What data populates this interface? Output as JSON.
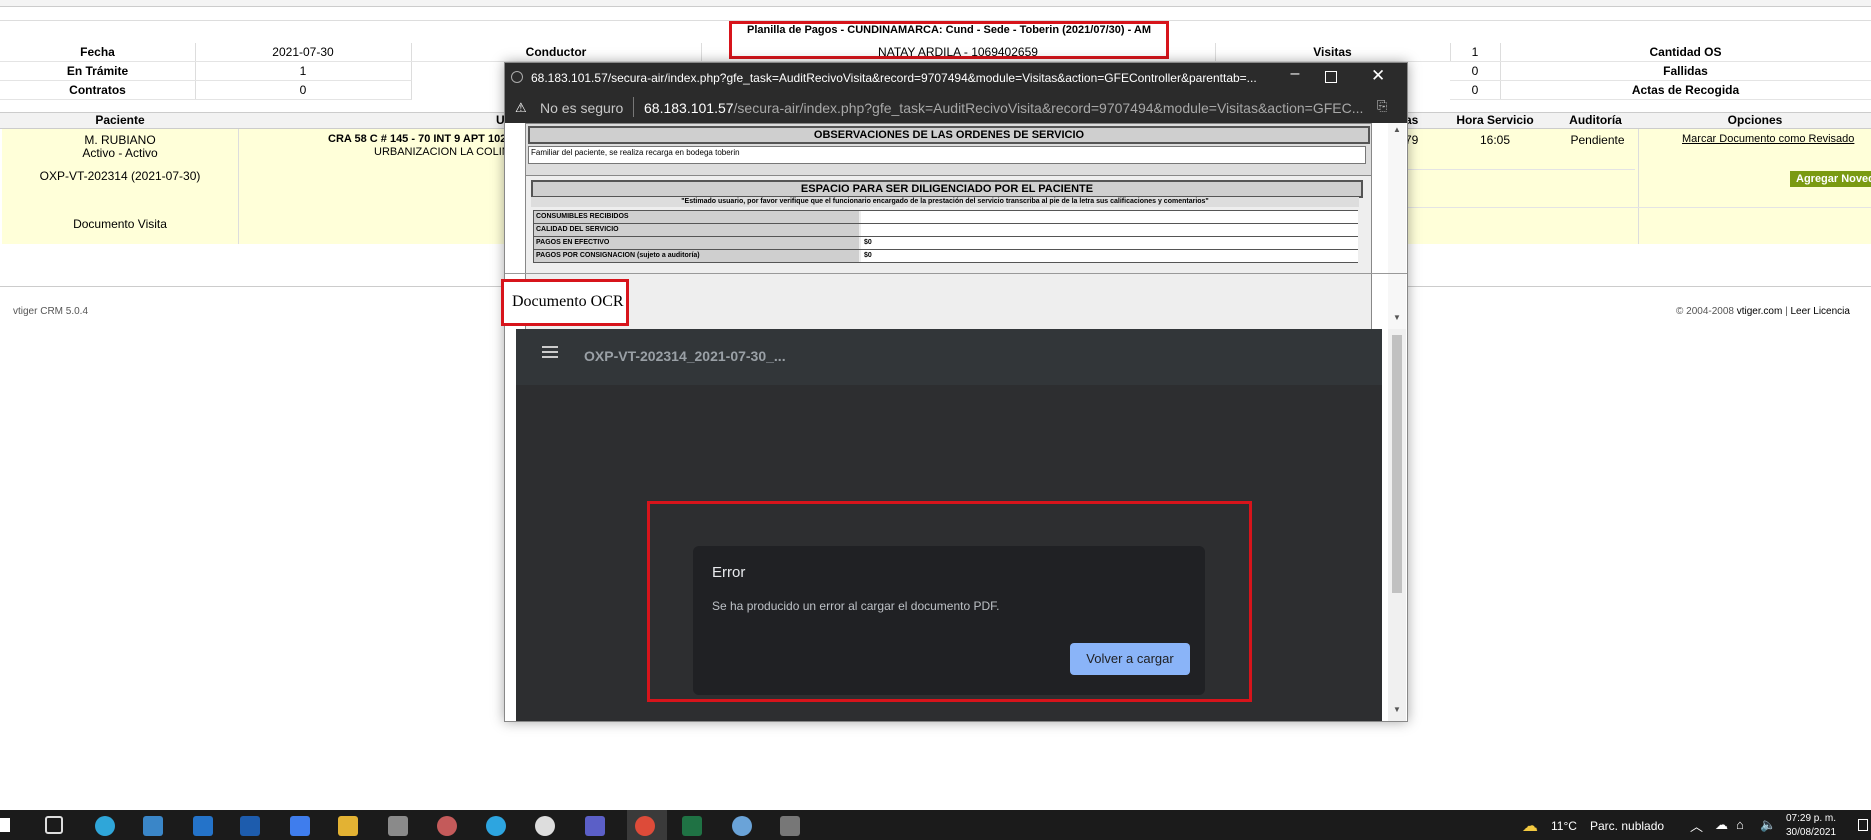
{
  "crm": {
    "title": "Planilla de Pagos - CUNDINAMARCA: Cund - Sede - Toberin (2021/07/30) - AM",
    "row1": {
      "fecha_label": "Fecha",
      "fecha_value": "2021-07-30",
      "conductor_label": "Conductor",
      "conductor_value": "NATAY ARDILA - 1069402659",
      "visitas_label": "Visitas",
      "visitas_value": "1",
      "cantidad_label": "Cantidad OS"
    },
    "row2": {
      "tramite_label": "En Trámite",
      "tramite_value": "1",
      "value2": "0",
      "fallidas_label": "Fallidas"
    },
    "row3": {
      "contratos_label": "Contratos",
      "contratos_value": "0",
      "value3": "0",
      "actas_label": "Actas de Recogida"
    },
    "headers": {
      "paciente": "Paciente",
      "u": "U",
      "as": "as",
      "hora": "Hora Servicio",
      "auditoria": "Auditoría",
      "opciones": "Opciones"
    },
    "row_data": {
      "name": "M. RUBIANO",
      "status": "Activo - Activo",
      "code": "OXP-VT-202314 (2021-07-30)",
      "doc": "Documento Visita",
      "address1": "CRA 58 C # 145 - 70 INT 9 APT 102",
      "address2": "URBANIZACION LA COLIN",
      "n79": "79",
      "hora": "16:05",
      "audit": "Pendiente",
      "mark": "Marcar Documento como Revisado",
      "add_btn": "Agregar Noved"
    },
    "footer_left": "vtiger CRM 5.0.4",
    "footer_right_prefix": "© 2004-2008 ",
    "footer_right_link1": "vtiger.com",
    "footer_right_sep": " | ",
    "footer_right_link2": "Leer Licencia"
  },
  "popup": {
    "title_url": "68.183.101.57/secura-air/index.php?gfe_task=AuditRecivoVisita&record=9707494&module=Visitas&action=GFEController&parenttab=...",
    "not_secure": "No es seguro",
    "address_host": "68.183.101.57",
    "address_path": "/secura-air/index.php?gfe_task=AuditRecivoVisita&record=9707494&module=Visitas&action=GFEC...",
    "obs_header": "OBSERVACIONES DE LAS ORDENES DE SERVICIO",
    "obs_text": "Familiar del paciente, se realiza recarga en bodega toberin",
    "space_header": "ESPACIO PARA SER DILIGENCIADO POR EL PACIENTE",
    "space_sub": "\"Estimado usuario, por favor verifique que el funcionario encargado de la prestación del servicio transcriba al pie de la letra sus calificaciones y comentarios\"",
    "rows": [
      {
        "label": "CONSUMIBLES RECIBIDOS",
        "value": ""
      },
      {
        "label": "CALIDAD DEL SERVICIO",
        "value": ""
      },
      {
        "label": "PAGOS EN EFECTIVO",
        "value": "$0"
      },
      {
        "label": "PAGOS POR CONSIGNACION (sujeto a auditoría)",
        "value": "$0"
      }
    ],
    "ocr_label": "Documento OCR",
    "pdf_filename": "OXP-VT-202314_2021-07-30_...",
    "error_title": "Error",
    "error_msg": "Se ha producido un error al cargar el documento PDF.",
    "reload": "Volver a cargar"
  },
  "taskbar": {
    "weather_temp": "11°C",
    "weather_desc": "Parc. nublado",
    "time": "07:29 p. m.",
    "date": "30/08/2021"
  },
  "colors": {
    "highlight": "#d7141b",
    "reload_btn": "#8ab4f8",
    "yellow_row": "#ffffd9"
  }
}
